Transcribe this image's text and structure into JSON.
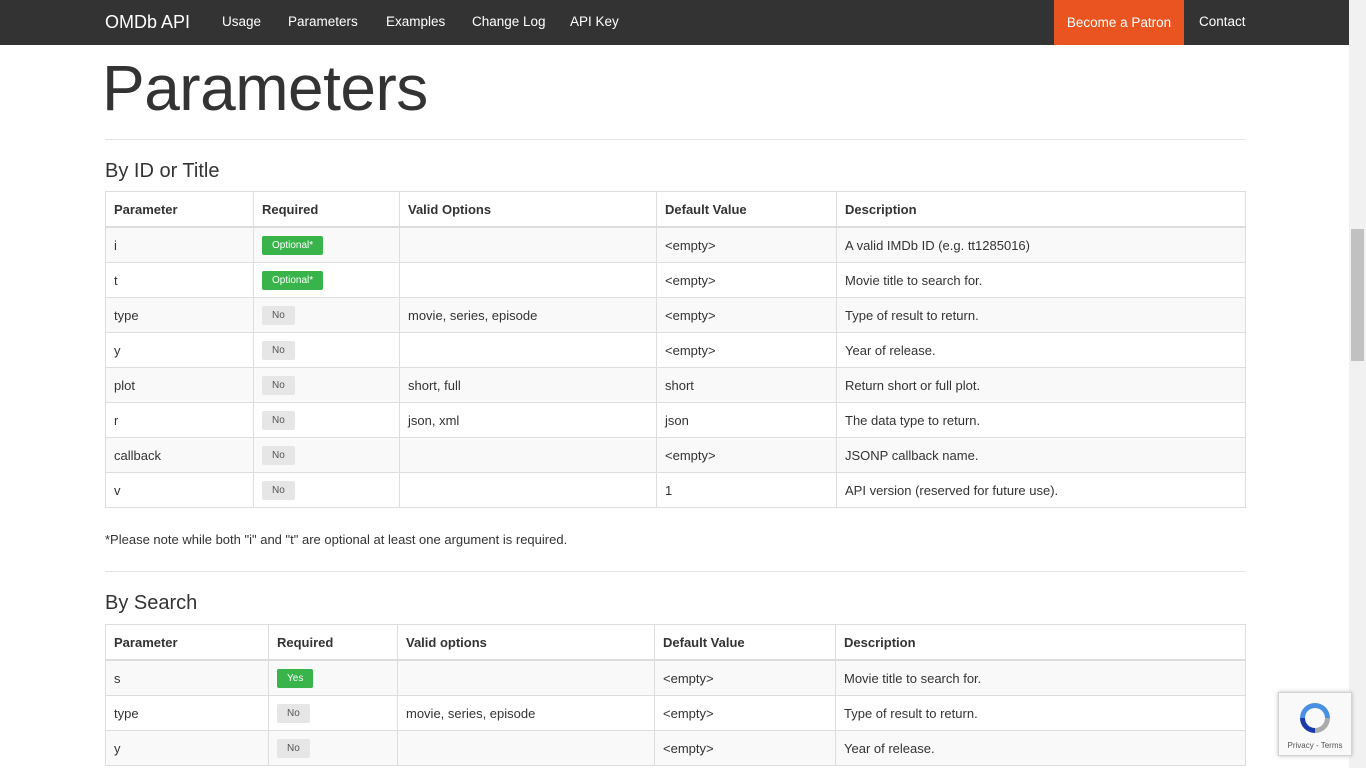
{
  "nav": {
    "brand": "OMDb API",
    "links": [
      "Usage",
      "Parameters",
      "Examples",
      "Change Log",
      "API Key"
    ],
    "cta": "Become a Patron",
    "contact": "Contact",
    "cta_color": "#e95420",
    "bg_color": "#333333"
  },
  "page": {
    "title": "Parameters"
  },
  "by_id": {
    "title": "By ID or Title",
    "headers": [
      "Parameter",
      "Required",
      "Valid Options",
      "Default Value",
      "Description"
    ],
    "rows": [
      {
        "param": "i",
        "required": "Optional*",
        "options": "",
        "default": "<empty>",
        "description": "A valid IMDb ID (e.g. tt1285016)"
      },
      {
        "param": "t",
        "required": "Optional*",
        "options": "",
        "default": "<empty>",
        "description": "Movie title to search for."
      },
      {
        "param": "type",
        "required": "No",
        "options": "movie, series, episode",
        "default": "<empty>",
        "description": "Type of result to return."
      },
      {
        "param": "y",
        "required": "No",
        "options": "",
        "default": "<empty>",
        "description": "Year of release."
      },
      {
        "param": "plot",
        "required": "No",
        "options": "short, full",
        "default": "short",
        "description": "Return short or full plot."
      },
      {
        "param": "r",
        "required": "No",
        "options": "json, xml",
        "default": "json",
        "description": "The data type to return."
      },
      {
        "param": "callback",
        "required": "No",
        "options": "",
        "default": "<empty>",
        "description": "JSONP callback name."
      },
      {
        "param": "v",
        "required": "No",
        "options": "",
        "default": "1",
        "description": "API version (reserved for future use)."
      }
    ],
    "note": "*Please note while both \"i\" and \"t\" are optional at least one argument is required."
  },
  "by_search": {
    "title": "By Search",
    "headers": [
      "Parameter",
      "Required",
      "Valid options",
      "Default Value",
      "Description"
    ],
    "rows": [
      {
        "param": "s",
        "required": "Yes",
        "options": "",
        "default": "<empty>",
        "description": "Movie title to search for."
      },
      {
        "param": "type",
        "required": "No",
        "options": "movie, series, episode",
        "default": "<empty>",
        "description": "Type of result to return."
      },
      {
        "param": "y",
        "required": "No",
        "options": "",
        "default": "<empty>",
        "description": "Year of release."
      }
    ]
  },
  "recaptcha": {
    "icon": "recaptcha-icon",
    "links": "Privacy - Terms"
  }
}
